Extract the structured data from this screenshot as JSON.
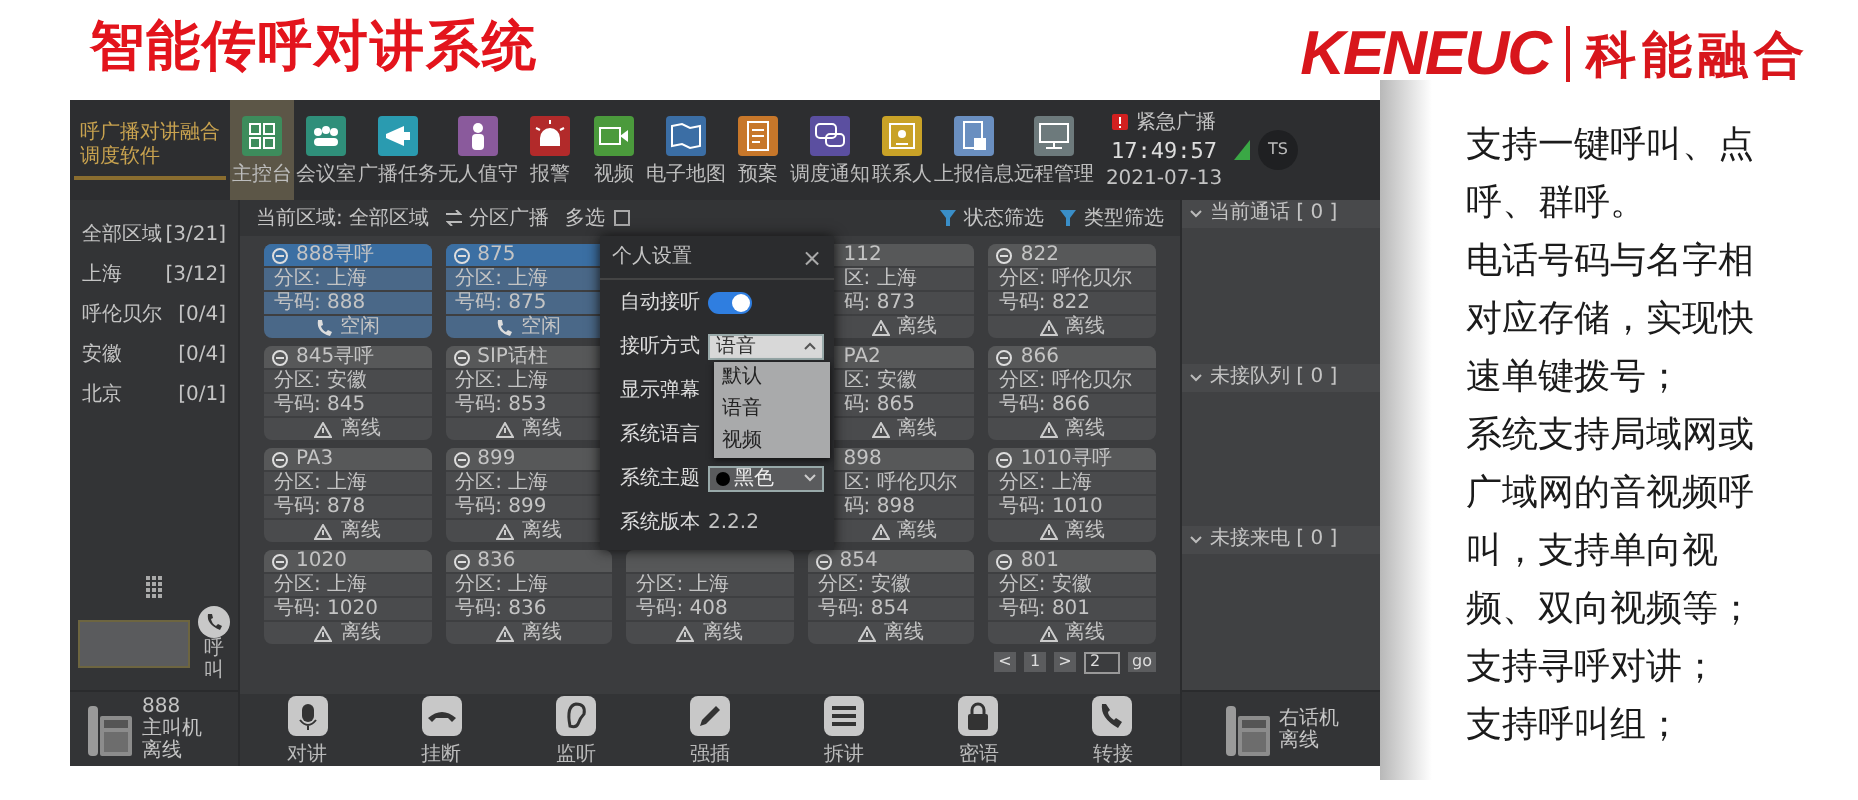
{
  "header": {
    "title": "智能传呼对讲系统",
    "logo_latin": "KENEUC",
    "logo_cjk": "科能融合"
  },
  "app": {
    "brand": "呼广播对讲融合调度软件",
    "nav": [
      {
        "label": "主控台",
        "selected": true,
        "color": "#3d8c5c"
      },
      {
        "label": "会议室",
        "selected": false,
        "color": "#2f8f7a"
      },
      {
        "label": "广播任务",
        "selected": false,
        "color": "#2a9bb0"
      },
      {
        "label": "无人值守",
        "selected": false,
        "color": "#8a5a9c"
      },
      {
        "label": "报警",
        "selected": false,
        "color": "#b22a2a"
      },
      {
        "label": "视频",
        "selected": false,
        "color": "#4b9a3c"
      },
      {
        "label": "电子地图",
        "selected": false,
        "color": "#3b6ea5"
      },
      {
        "label": "预案",
        "selected": false,
        "color": "#c7772a"
      },
      {
        "label": "调度通知",
        "selected": false,
        "color": "#5b4fa0"
      },
      {
        "label": "联系人",
        "selected": false,
        "color": "#c9a227"
      },
      {
        "label": "上报信息",
        "selected": false,
        "color": "#6a8fc0"
      },
      {
        "label": "远程管理",
        "selected": false,
        "color": "#6d7a7c"
      }
    ],
    "emergency": "紧急广播",
    "time": "17:49:57",
    "date": "2021-07-13",
    "avatar": "TS",
    "regions": [
      {
        "name": "全部区域",
        "count": "[3/21]"
      },
      {
        "name": "上海",
        "count": "[3/12]"
      },
      {
        "name": "呼伦贝尔",
        "count": "[0/4]"
      },
      {
        "name": "安徽",
        "count": "[0/4]"
      },
      {
        "name": "北京",
        "count": "[0/1]"
      }
    ],
    "call_button": "呼叫",
    "left_phone": {
      "number": "888",
      "role": "主叫机",
      "status": "离线"
    },
    "toolbar": {
      "current_area": "当前区域: 全部区域",
      "broadcast": "分区广播",
      "multi_select": "多选",
      "multi_checked": false,
      "status_filter": "状态筛选",
      "type_filter": "类型筛选"
    },
    "cards": [
      [
        {
          "kind": "normal",
          "title": "888寻呼",
          "zone": "分区: 上海",
          "number": "号码: 888",
          "status": "空闲",
          "online": true
        },
        {
          "kind": "normal",
          "title": "875",
          "zone": "分区: 上海",
          "number": "号码: 875",
          "status": "空闲",
          "online": true
        },
        {
          "kind": "hidden"
        },
        {
          "kind": "partial",
          "title": "112",
          "zone": "区: 上海",
          "number": "码: 873",
          "status": "离线",
          "online": false
        },
        {
          "kind": "normal",
          "title": "822",
          "zone": "分区: 呼伦贝尔",
          "number": "号码: 822",
          "status": "离线",
          "online": false
        }
      ],
      [
        {
          "kind": "normal",
          "title": "845寻呼",
          "zone": "分区: 安徽",
          "number": "号码: 845",
          "status": "离线",
          "online": false
        },
        {
          "kind": "normal",
          "title": "SIP话柱",
          "zone": "分区: 上海",
          "number": "号码: 853",
          "status": "离线",
          "online": false
        },
        {
          "kind": "hidden"
        },
        {
          "kind": "partial",
          "title": "PA2",
          "zone": "区: 安徽",
          "number": "码: 865",
          "status": "离线",
          "online": false
        },
        {
          "kind": "normal",
          "title": "866",
          "zone": "分区: 呼伦贝尔",
          "number": "号码: 866",
          "status": "离线",
          "online": false
        }
      ],
      [
        {
          "kind": "normal",
          "title": "PA3",
          "zone": "分区: 上海",
          "number": "号码: 878",
          "status": "离线",
          "online": false
        },
        {
          "kind": "normal",
          "title": "899",
          "zone": "分区: 上海",
          "number": "号码: 899",
          "status": "离线",
          "online": false
        },
        {
          "kind": "hidden"
        },
        {
          "kind": "partial",
          "title": "898",
          "zone": "区: 呼伦贝尔",
          "number": "码: 898",
          "status": "离线",
          "online": false
        },
        {
          "kind": "normal",
          "title": "1010寻呼",
          "zone": "分区: 上海",
          "number": "号码: 1010",
          "status": "离线",
          "online": false
        }
      ],
      [
        {
          "kind": "normal",
          "title": "1020",
          "zone": "分区: 上海",
          "number": "号码: 1020",
          "status": "离线",
          "online": false
        },
        {
          "kind": "normal",
          "title": "836",
          "zone": "分区: 上海",
          "number": "号码: 836",
          "status": "离线",
          "online": false
        },
        {
          "kind": "untitled",
          "zone": "分区: 上海",
          "number": "号码: 408",
          "status": "离线",
          "online": false
        },
        {
          "kind": "normal",
          "title": "854",
          "zone": "分区: 安徽",
          "number": "号码: 854",
          "status": "离线",
          "online": false
        },
        {
          "kind": "normal",
          "title": "801",
          "zone": "分区: 安徽",
          "number": "号码: 801",
          "status": "离线",
          "online": false
        }
      ]
    ],
    "pagination": {
      "prev": "<",
      "page": "1",
      "next": ">",
      "page_input": "2",
      "go": "go"
    },
    "actions": [
      {
        "label": "对讲"
      },
      {
        "label": "挂断"
      },
      {
        "label": "监听"
      },
      {
        "label": "强插"
      },
      {
        "label": "拆讲"
      },
      {
        "label": "密语"
      },
      {
        "label": "转接"
      }
    ],
    "queues": [
      {
        "title": "当前通话 [ 0 ]"
      },
      {
        "title": "未接队列 [ 0 ]"
      },
      {
        "title": "未接来电 [ 0 ]"
      }
    ],
    "right_phone": {
      "role": "右话机",
      "status": "离线"
    },
    "settings": {
      "title": "个人设置",
      "close": "×",
      "rows": [
        {
          "kind": "toggle",
          "label": "自动接听",
          "on": true
        },
        {
          "kind": "select",
          "label": "接听方式",
          "value": "语音",
          "expanded": true,
          "options": [
            "默认",
            "语音",
            "视频"
          ]
        },
        {
          "kind": "blank",
          "label": "显示弹幕"
        },
        {
          "kind": "blank",
          "label": "系统语言"
        },
        {
          "kind": "select",
          "label": "系统主题",
          "value": "黑色",
          "expanded": false,
          "swatch": true
        },
        {
          "kind": "text",
          "label": "系统版本",
          "value": "2.2.2"
        }
      ]
    }
  },
  "features": [
    "支持一键呼叫、点呼、群呼。",
    "电话号码与名字相对应存储，实现快速单键拨号；",
    "系统支持局域网或广域网的音视频呼叫，支持单向视频、双向视频等；",
    "支持寻呼对讲；",
    "支持呼叫组；"
  ]
}
